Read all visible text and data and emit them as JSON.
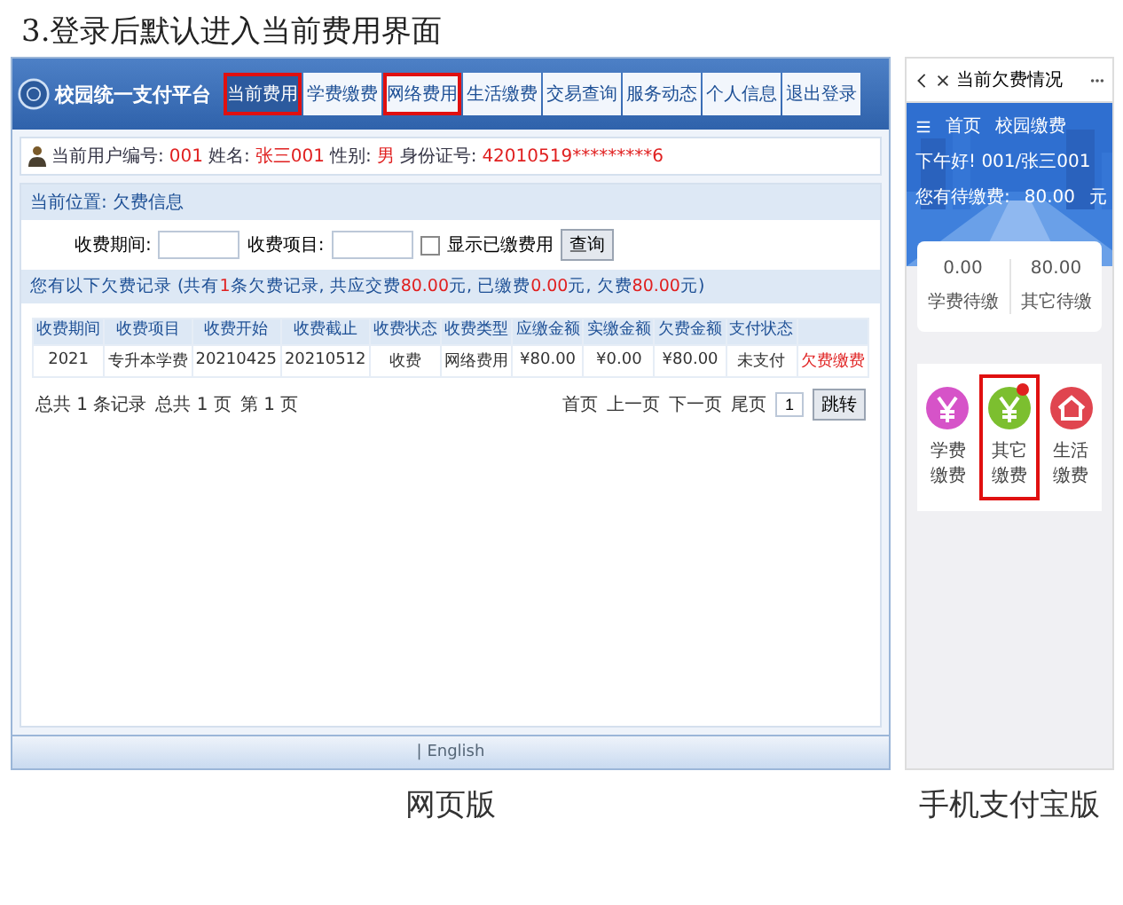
{
  "heading": "3.登录后默认进入当前费用界面",
  "web": {
    "site_title": "校园统一支付平台",
    "tabs": [
      {
        "label": "当前费用",
        "selected": true,
        "highlighted": true
      },
      {
        "label": "学费缴费",
        "selected": false,
        "highlighted": false
      },
      {
        "label": "网络费用",
        "selected": false,
        "highlighted": true
      },
      {
        "label": "生活缴费",
        "selected": false,
        "highlighted": false
      },
      {
        "label": "交易查询",
        "selected": false,
        "highlighted": false
      },
      {
        "label": "服务动态",
        "selected": false,
        "highlighted": false
      },
      {
        "label": "个人信息",
        "selected": false,
        "highlighted": false
      },
      {
        "label": "退出登录",
        "selected": false,
        "highlighted": false
      }
    ],
    "user_info": [
      {
        "text": "当前用户编号:",
        "highlight": false
      },
      {
        "text": "001",
        "highlight": true
      },
      {
        "text": "姓名:",
        "highlight": false
      },
      {
        "text": "张三001",
        "highlight": true
      },
      {
        "text": "性别:",
        "highlight": false
      },
      {
        "text": "男",
        "highlight": true
      },
      {
        "text": "身份证号:",
        "highlight": false
      },
      {
        "text": "42010519*********6",
        "highlight": true
      }
    ],
    "location": "当前位置: 欠费信息",
    "filters": {
      "fields": [
        {
          "label": "收费期间:"
        },
        {
          "label": "收费项目:"
        }
      ],
      "checkbox": {
        "label": "显示已缴费用",
        "checked": false
      },
      "button": "查询"
    },
    "summary": [
      {
        "text": "您有以下欠费记录 (共有",
        "highlight": false
      },
      {
        "text": "1",
        "highlight": true
      },
      {
        "text": "条欠费记录, 共应交费",
        "highlight": false
      },
      {
        "text": "80.00",
        "highlight": true
      },
      {
        "text": "元, 已缴费",
        "highlight": false
      },
      {
        "text": "0.00",
        "highlight": true
      },
      {
        "text": "元, 欠费",
        "highlight": false
      },
      {
        "text": "80.00",
        "highlight": true
      },
      {
        "text": "元)",
        "highlight": false
      }
    ],
    "table": {
      "columns": [
        "收费期间",
        "收费项目",
        "收费开始",
        "收费截止",
        "收费状态",
        "收费类型",
        "应缴金额",
        "实缴金额",
        "欠费金额",
        "支付状态"
      ],
      "rows": [
        {
          "cells": [
            "2021",
            "专升本学费",
            "20210425",
            "20210512",
            "收费",
            "网络费用",
            "¥80.00",
            "¥0.00",
            "¥80.00",
            "未支付"
          ],
          "action": "欠费缴费"
        }
      ]
    },
    "pager": {
      "info": [
        "总共 1 条记录",
        "总共 1 页",
        "第 1 页"
      ],
      "links": [
        "首页",
        "上一页",
        "下一页",
        "尾页"
      ],
      "page_value": "1",
      "button": "跳转"
    },
    "footer": "| English",
    "caption": "网页版"
  },
  "phone": {
    "title": "当前欠费情况",
    "nav": "首页",
    "app_name": "校园缴费",
    "greeting": "下午好! 001/张三001",
    "due_label": "您有待缴费:",
    "due_amount": "80.00",
    "due_unit": "元",
    "balances": [
      {
        "amount": "0.00",
        "label": "学费待缴"
      },
      {
        "amount": "80.00",
        "label": "其它待缴"
      }
    ],
    "services": [
      {
        "label": "学费缴费",
        "kind": "yen",
        "color": "#d653c8",
        "badge": false,
        "highlighted": false
      },
      {
        "label": "其它缴费",
        "kind": "yen",
        "color": "#7cbf2f",
        "badge": true,
        "highlighted": true
      },
      {
        "label": "生活缴费",
        "kind": "house",
        "color": "#e0454f",
        "badge": false,
        "highlighted": false
      }
    ],
    "caption": "手机支付宝版"
  }
}
